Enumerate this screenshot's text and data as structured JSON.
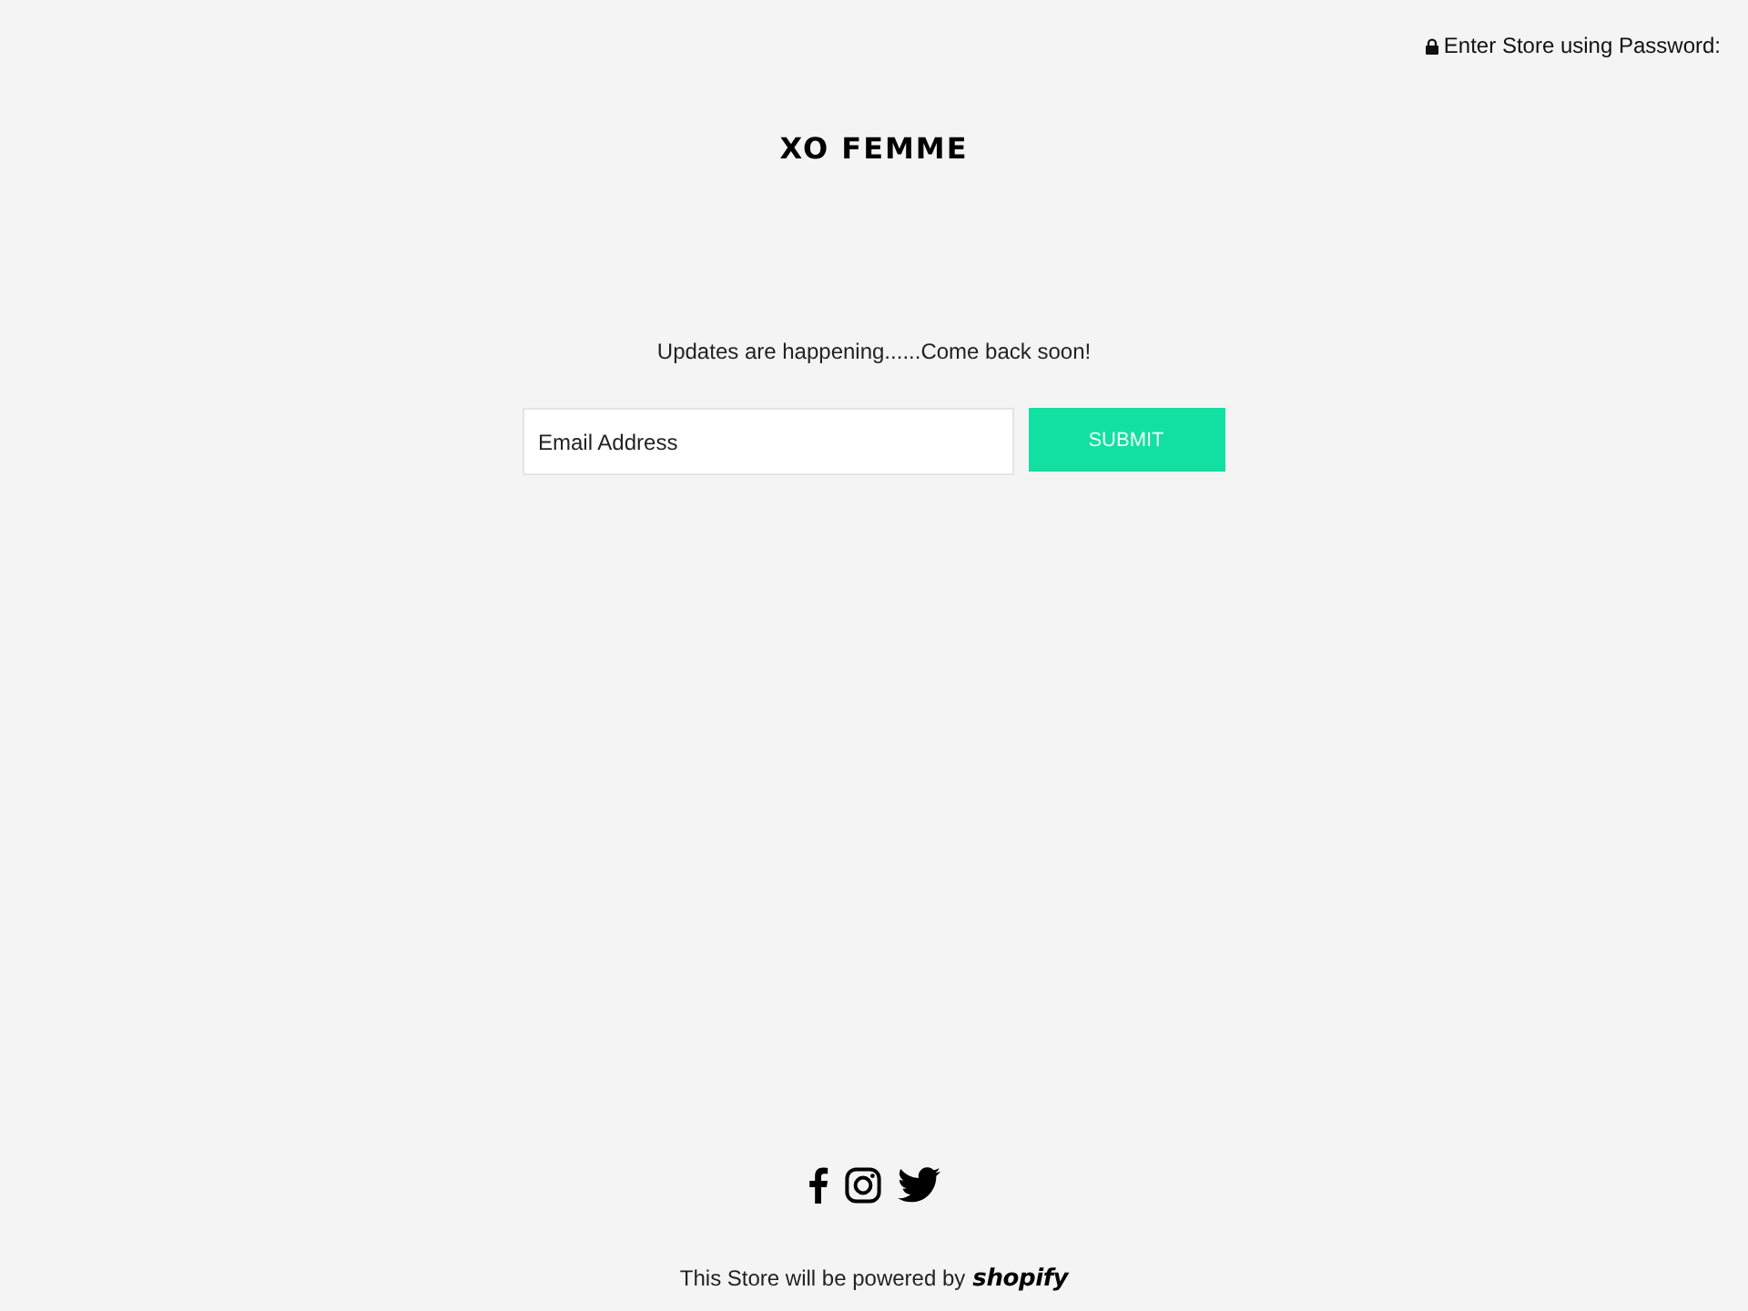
{
  "password_link": {
    "label": "Enter Store using Password:"
  },
  "store_name": "XO FEMME",
  "message": "Updates are happening......Come back soon!",
  "signup": {
    "email": {
      "placeholder": "Email Address"
    },
    "submit": "SUBMIT"
  },
  "social_links": [
    {
      "kind": "facebook"
    },
    {
      "kind": "instagram"
    },
    {
      "kind": "twitter"
    }
  ],
  "footer": {
    "text": "This Store will be powered by",
    "logo": "shopify"
  }
}
